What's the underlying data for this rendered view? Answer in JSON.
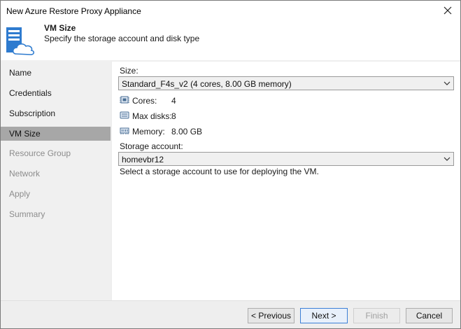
{
  "window": {
    "title": "New Azure Restore Proxy Appliance"
  },
  "header": {
    "title": "VM Size",
    "subtitle": "Specify the storage account and disk type"
  },
  "nav": {
    "items": [
      {
        "label": "Name",
        "state": "done"
      },
      {
        "label": "Credentials",
        "state": "done"
      },
      {
        "label": "Subscription",
        "state": "done"
      },
      {
        "label": "VM Size",
        "state": "active"
      },
      {
        "label": "Resource Group",
        "state": "disabled"
      },
      {
        "label": "Network",
        "state": "disabled"
      },
      {
        "label": "Apply",
        "state": "disabled"
      },
      {
        "label": "Summary",
        "state": "disabled"
      }
    ]
  },
  "size": {
    "label": "Size:",
    "value": "Standard_F4s_v2 (4 cores, 8.00 GB memory)",
    "specs": [
      {
        "icon": "cpu-icon",
        "label": "Cores:",
        "value": "4"
      },
      {
        "icon": "disk-icon",
        "label": "Max disks:",
        "value": "8"
      },
      {
        "icon": "memory-icon",
        "label": "Memory:",
        "value": "8.00 GB"
      }
    ]
  },
  "storage": {
    "label": "Storage account:",
    "value": "homevbr12",
    "hint": "Select a storage account to use for deploying the VM."
  },
  "buttons": {
    "previous": "< Previous",
    "next": "Next >",
    "finish": "Finish",
    "cancel": "Cancel"
  },
  "colors": {
    "accent": "#3c7fd6",
    "nav_active": "#a7a7a7",
    "icon_blue": "#2e7bcf"
  }
}
